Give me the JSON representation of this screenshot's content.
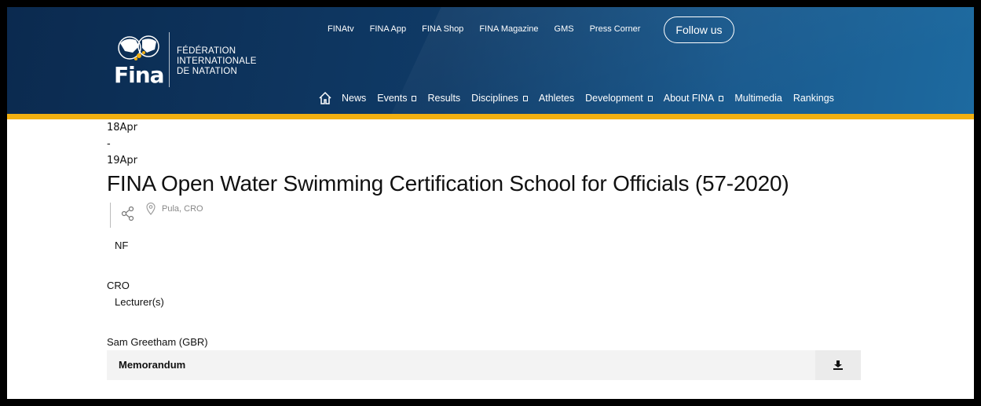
{
  "header": {
    "logo": {
      "wordmark": "Fina",
      "federation_lines": [
        "FÉDÉRATION",
        "INTERNATIONALE",
        "DE NATATION"
      ]
    },
    "top_links": [
      "FINAtv",
      "FINA App",
      "FINA Shop",
      "FINA Magazine",
      "GMS",
      "Press Corner"
    ],
    "follow_label": "Follow us",
    "nav": [
      {
        "label": "News",
        "dropdown": false
      },
      {
        "label": "Events",
        "dropdown": true
      },
      {
        "label": "Results",
        "dropdown": false
      },
      {
        "label": "Disciplines",
        "dropdown": true
      },
      {
        "label": "Athletes",
        "dropdown": false
      },
      {
        "label": "Development",
        "dropdown": true
      },
      {
        "label": "About FINA",
        "dropdown": true
      },
      {
        "label": "Multimedia",
        "dropdown": false
      },
      {
        "label": "Rankings",
        "dropdown": false
      }
    ],
    "icons": {
      "home": "home-icon"
    },
    "colors": {
      "accent_bar": "#f2b011",
      "header_bg": "#0f3a66"
    }
  },
  "event": {
    "date_start": "18Apr",
    "date_separator": "-",
    "date_end": "19Apr",
    "title": "FINA Open Water Swimming Certification School for Officials (57-2020)",
    "location": "Pula, CRO",
    "organizer_label": "NF",
    "organizer_value": "CRO",
    "lecturer_label": "Lecturer(s)",
    "lecturer_value": "Sam Greetham (GBR)",
    "document_label": "Memorandum",
    "icons": {
      "share": "share-icon",
      "location": "map-pin-icon",
      "download": "download-icon"
    }
  }
}
